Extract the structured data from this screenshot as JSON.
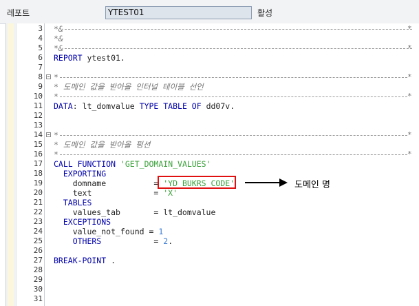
{
  "header": {
    "report_label": "레포트",
    "report_value": "YTEST01",
    "status_label": "활성"
  },
  "editor": {
    "lines": [
      {
        "no": "3",
        "fold": false,
        "kind": "rule-comment",
        "text": "*&"
      },
      {
        "no": "4",
        "fold": false,
        "kind": "comment",
        "text": "*&"
      },
      {
        "no": "5",
        "fold": false,
        "kind": "rule-comment",
        "text": "*&"
      },
      {
        "no": "6",
        "fold": false,
        "kind": "code",
        "tokens": [
          {
            "t": "REPORT",
            "c": "kw"
          },
          {
            "t": " ytest01.",
            "c": "txt"
          }
        ]
      },
      {
        "no": "7",
        "fold": false,
        "kind": "blank"
      },
      {
        "no": "8",
        "fold": true,
        "kind": "rule-comment",
        "text": "*"
      },
      {
        "no": "9",
        "fold": false,
        "kind": "comment",
        "text": "* 도메인 값을 받아올 인터널 테이블 선언"
      },
      {
        "no": "10",
        "fold": false,
        "kind": "rule-comment",
        "text": "*"
      },
      {
        "no": "11",
        "fold": false,
        "kind": "code",
        "tokens": [
          {
            "t": "DATA",
            "c": "kw"
          },
          {
            "t": ": lt_domvalue ",
            "c": "txt"
          },
          {
            "t": "TYPE TABLE OF",
            "c": "kw"
          },
          {
            "t": " dd07v.",
            "c": "txt"
          }
        ]
      },
      {
        "no": "12",
        "fold": false,
        "kind": "blank"
      },
      {
        "no": "13",
        "fold": false,
        "kind": "blank"
      },
      {
        "no": "14",
        "fold": true,
        "kind": "rule-comment",
        "text": "*"
      },
      {
        "no": "15",
        "fold": false,
        "kind": "comment",
        "text": "* 도메인 값을 받아올 펑션"
      },
      {
        "no": "16",
        "fold": false,
        "kind": "rule-comment",
        "text": "*"
      },
      {
        "no": "17",
        "fold": false,
        "kind": "code",
        "tokens": [
          {
            "t": "CALL FUNCTION",
            "c": "kw"
          },
          {
            "t": " ",
            "c": "txt"
          },
          {
            "t": "'GET_DOMAIN_VALUES'",
            "c": "str"
          }
        ]
      },
      {
        "no": "18",
        "fold": false,
        "kind": "code",
        "tokens": [
          {
            "t": "  EXPORTING",
            "c": "kw"
          }
        ]
      },
      {
        "no": "19",
        "fold": false,
        "kind": "code",
        "tokens": [
          {
            "t": "    domname          = ",
            "c": "txt"
          },
          {
            "t": "'YD_BUKRS_CODE'",
            "c": "str"
          }
        ]
      },
      {
        "no": "20",
        "fold": false,
        "kind": "code",
        "tokens": [
          {
            "t": "    text             = ",
            "c": "txt"
          },
          {
            "t": "'X'",
            "c": "str"
          }
        ]
      },
      {
        "no": "21",
        "fold": false,
        "kind": "code",
        "tokens": [
          {
            "t": "  TABLES",
            "c": "kw"
          }
        ]
      },
      {
        "no": "22",
        "fold": false,
        "kind": "code",
        "tokens": [
          {
            "t": "    values_tab       = lt_domvalue",
            "c": "txt"
          }
        ]
      },
      {
        "no": "23",
        "fold": false,
        "kind": "code",
        "tokens": [
          {
            "t": "  EXCEPTIONS",
            "c": "kw"
          }
        ]
      },
      {
        "no": "24",
        "fold": false,
        "kind": "code",
        "tokens": [
          {
            "t": "    value_not_found = ",
            "c": "txt"
          },
          {
            "t": "1",
            "c": "num"
          }
        ]
      },
      {
        "no": "25",
        "fold": false,
        "kind": "code",
        "tokens": [
          {
            "t": "    OTHERS",
            "c": "kw"
          },
          {
            "t": "           = ",
            "c": "txt"
          },
          {
            "t": "2",
            "c": "num"
          },
          {
            "t": ".",
            "c": "txt"
          }
        ]
      },
      {
        "no": "26",
        "fold": false,
        "kind": "blank"
      },
      {
        "no": "27",
        "fold": false,
        "kind": "code",
        "tokens": [
          {
            "t": "BREAK-POINT",
            "c": "kw"
          },
          {
            "t": " .",
            "c": "txt"
          }
        ]
      },
      {
        "no": "28",
        "fold": false,
        "kind": "blank"
      },
      {
        "no": "29",
        "fold": false,
        "kind": "blank"
      },
      {
        "no": "30",
        "fold": false,
        "kind": "blank"
      },
      {
        "no": "31",
        "fold": false,
        "kind": "blank"
      }
    ]
  },
  "annotation": {
    "label": "도메인 명"
  }
}
